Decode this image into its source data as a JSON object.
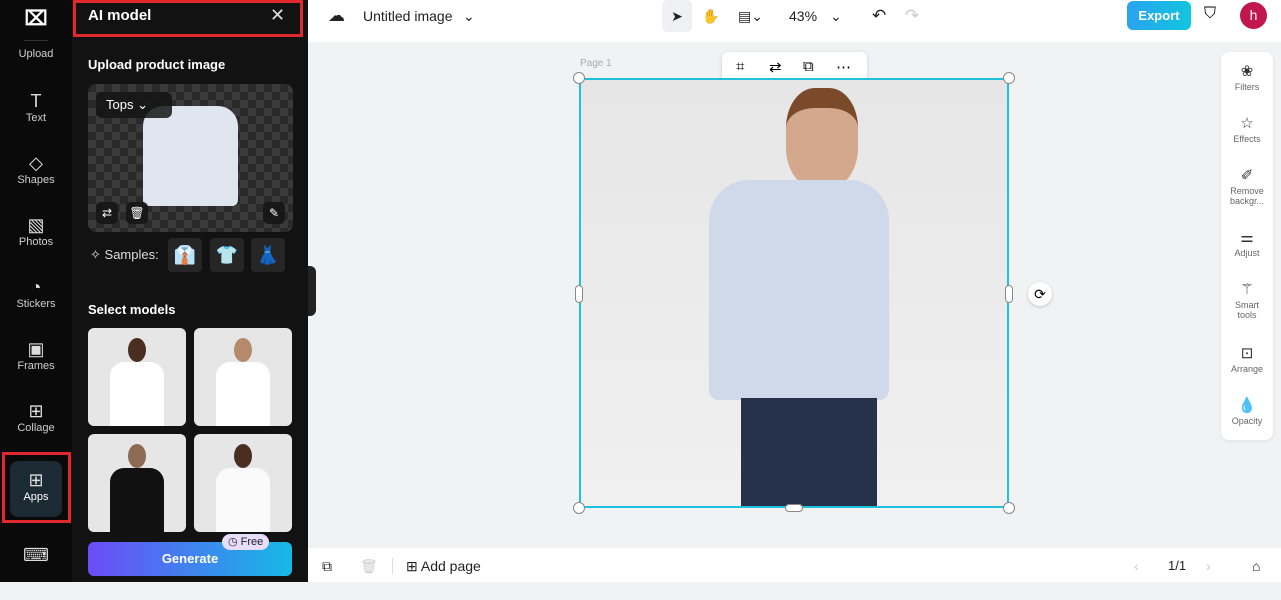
{
  "rail": {
    "items": [
      {
        "label": "Upload",
        "icon": "upload-icon"
      },
      {
        "label": "Text",
        "icon": "text-icon"
      },
      {
        "label": "Shapes",
        "icon": "shapes-icon"
      },
      {
        "label": "Photos",
        "icon": "photos-icon"
      },
      {
        "label": "Stickers",
        "icon": "stickers-icon"
      },
      {
        "label": "Frames",
        "icon": "frames-icon"
      },
      {
        "label": "Collage",
        "icon": "collage-icon"
      },
      {
        "label": "Apps",
        "icon": "apps-icon",
        "active": true
      }
    ]
  },
  "panel": {
    "title": "AI model",
    "upload_heading": "Upload product image",
    "category": "Tops",
    "samples_label": "Samples:",
    "select_models": "Select models",
    "generate": "Generate",
    "free_badge": "Free"
  },
  "topbar": {
    "title": "Untitled image",
    "zoom": "43%",
    "export": "Export",
    "avatar": "h"
  },
  "canvas": {
    "page_label": "Page 1"
  },
  "right_tools": [
    "Filters",
    "Effects",
    "Remove backgr...",
    "Adjust",
    "Smart tools",
    "Arrange",
    "Opacity"
  ],
  "bottom": {
    "add_page": "Add page",
    "page_count": "1/1"
  },
  "colors": {
    "accent": "#1fc1dd",
    "highlight": "#e0282e",
    "export": "#12c5de"
  }
}
